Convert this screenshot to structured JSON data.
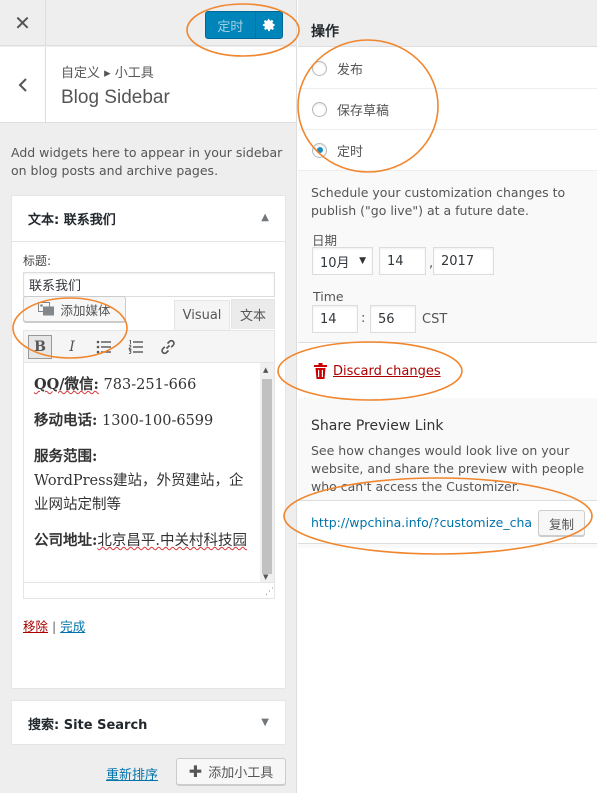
{
  "header": {
    "close_glyph": "✕",
    "publish_label": "定时"
  },
  "section": {
    "breadcrumb": "自定义 ▸ 小工具",
    "title": "Blog Sidebar",
    "description": "Add widgets here to appear in your sidebar on blog posts and archive pages."
  },
  "text_widget": {
    "header": "文本: 联系我们",
    "title_label": "标题:",
    "title_value": "联系我们",
    "add_media_label": "添加媒体",
    "tab_visual": "Visual",
    "tab_text": "文本",
    "content": {
      "qq_label": "QQ/微信:",
      "qq_value": "783-251-666",
      "phone_label": "移动电话:",
      "phone_value": "1300-100-6599",
      "service_label": "服务范围:",
      "service_value": "WordPress建站，外贸建站，企业网站定制等",
      "address_label": "公司地址:",
      "address_value": "北京昌平.中关村科技园"
    },
    "remove_label": "移除",
    "separator": "|",
    "done_label": "完成"
  },
  "search_widget": {
    "header": "搜索: Site Search"
  },
  "footer": {
    "reorder_label": "重新排序",
    "add_widget_label": "添加小工具"
  },
  "actions": {
    "heading": "操作",
    "options": [
      "发布",
      "保存草稿",
      "定时"
    ],
    "selected": "定时"
  },
  "schedule": {
    "description": "Schedule your customization changes to publish (\"go live\") at a future date.",
    "date_label": "日期",
    "month": "10月",
    "day": "14",
    "year": "2017",
    "time_label": "Time",
    "hour": "14",
    "minute": "56",
    "timezone": "CST",
    "time_sep": ":",
    "date_sep": ","
  },
  "discard": {
    "label": "Discard changes"
  },
  "share": {
    "title": "Share Preview Link",
    "description": "See how changes would look live on your website, and share the preview with people who can't access the Customizer.",
    "url": "http://wpchina.info/?customize_changeset_uuid",
    "copy_label": "复制"
  },
  "colors": {
    "accent": "#0085ba",
    "annotation": "#f0862e",
    "danger": "#a00000",
    "link": "#0073aa"
  }
}
